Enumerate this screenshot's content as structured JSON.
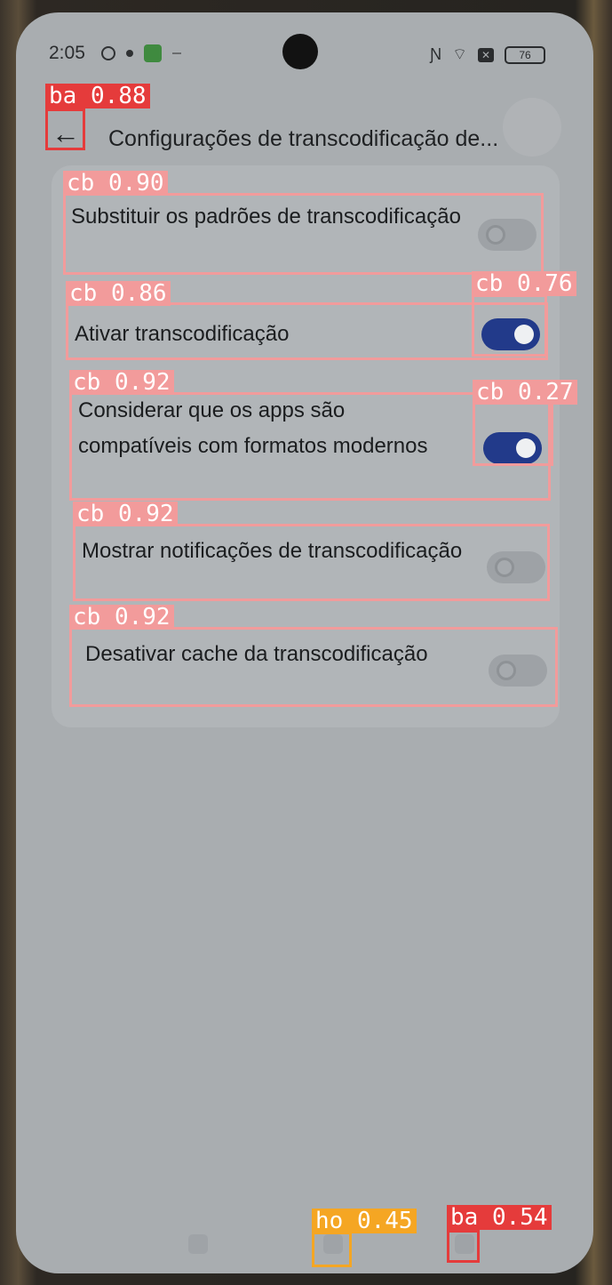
{
  "status_bar": {
    "time": "2:05",
    "battery": "76"
  },
  "toolbar": {
    "back_icon": "arrow-left-icon",
    "title": "Configurações de transcodificação de..."
  },
  "settings": [
    {
      "label": "Substituir os padrões de transcodificação",
      "state": "off"
    },
    {
      "label": "Ativar transcodificação",
      "state": "on"
    },
    {
      "label": "Considerar que os apps são compatíveis com formatos modernos",
      "state": "on"
    },
    {
      "label": "Mostrar notificações de transcodificação",
      "state": "off"
    },
    {
      "label": "Desativar cache da transcodificação",
      "state": "off"
    }
  ],
  "detections": [
    {
      "label": "ba 0.88",
      "color": "#e53b3b"
    },
    {
      "label": "cb 0.90",
      "color": "#f29b9b"
    },
    {
      "label": "cb 0.86",
      "color": "#f29b9b"
    },
    {
      "label": "cb 0.76",
      "color": "#f29b9b"
    },
    {
      "label": "cb 0.92",
      "color": "#f29b9b"
    },
    {
      "label": "cb 0.27",
      "color": "#f29b9b"
    },
    {
      "label": "cb 0.92",
      "color": "#f29b9b"
    },
    {
      "label": "cb 0.92",
      "color": "#f29b9b"
    },
    {
      "label": "ho 0.45",
      "color": "#f5a623"
    },
    {
      "label": "ba 0.54",
      "color": "#e53b3b"
    }
  ],
  "colors": {
    "switch_on": "#223a8a",
    "switch_off": "#9ea2a6"
  }
}
